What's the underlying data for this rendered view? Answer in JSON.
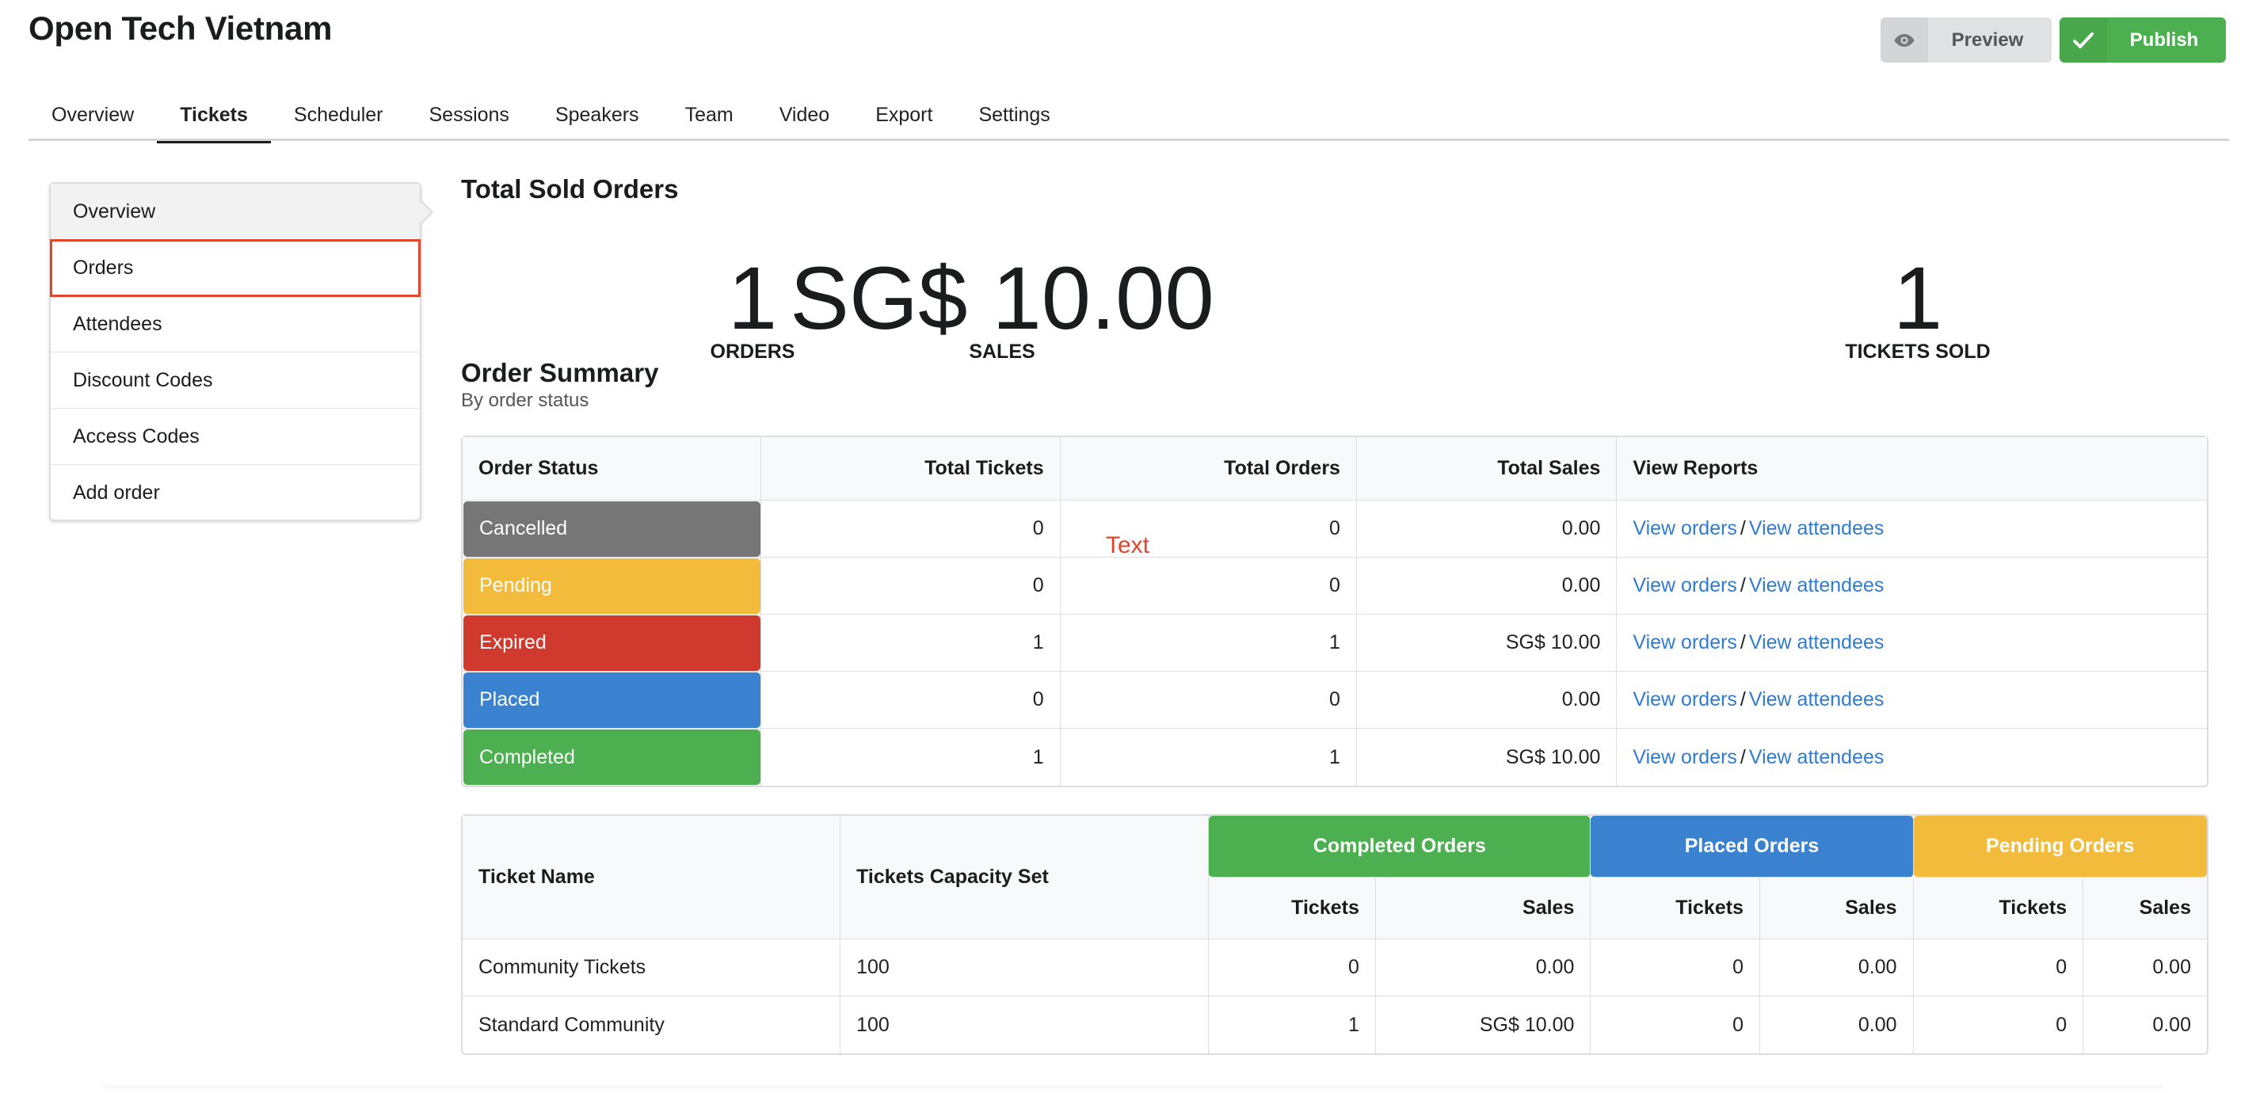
{
  "header": {
    "title": "Open Tech Vietnam",
    "preview_label": "Preview",
    "publish_label": "Publish"
  },
  "tabs": [
    {
      "label": "Overview"
    },
    {
      "label": "Tickets"
    },
    {
      "label": "Scheduler"
    },
    {
      "label": "Sessions"
    },
    {
      "label": "Speakers"
    },
    {
      "label": "Team"
    },
    {
      "label": "Video"
    },
    {
      "label": "Export"
    },
    {
      "label": "Settings"
    }
  ],
  "sidebar": {
    "items": [
      {
        "label": "Overview"
      },
      {
        "label": "Orders"
      },
      {
        "label": "Attendees"
      },
      {
        "label": "Discount Codes"
      },
      {
        "label": "Access Codes"
      },
      {
        "label": "Add order"
      }
    ]
  },
  "stats": {
    "title": "Total Sold Orders",
    "orders_value": "1",
    "orders_label": "ORDERS",
    "sales_value": "SG$ 10.00",
    "sales_label": "SALES",
    "tickets_value": "1",
    "tickets_label": "TICKETS SOLD"
  },
  "summary": {
    "title": "Order Summary",
    "subtitle": "By order status",
    "overlay_text": "Text",
    "headers": {
      "status": "Order Status",
      "tickets": "Total Tickets",
      "orders": "Total Orders",
      "sales": "Total Sales",
      "reports": "View Reports"
    },
    "links": {
      "orders": "View orders",
      "separator": "/",
      "attendees": "View attendees"
    },
    "rows": [
      {
        "status": "Cancelled",
        "tickets": "0",
        "orders": "0",
        "sales": "0.00"
      },
      {
        "status": "Pending",
        "tickets": "0",
        "orders": "0",
        "sales": "0.00"
      },
      {
        "status": "Expired",
        "tickets": "1",
        "orders": "1",
        "sales": "SG$ 10.00"
      },
      {
        "status": "Placed",
        "tickets": "0",
        "orders": "0",
        "sales": "0.00"
      },
      {
        "status": "Completed",
        "tickets": "1",
        "orders": "1",
        "sales": "SG$ 10.00"
      }
    ]
  },
  "status_colors": {
    "Cancelled": "#767676",
    "Pending": "#f2bb3c",
    "Expired": "#d0392e",
    "Placed": "#3a82cf",
    "Completed": "#4caf50"
  },
  "ticket_table": {
    "headers": {
      "name": "Ticket Name",
      "capacity": "Tickets Capacity Set",
      "completed": "Completed Orders",
      "placed": "Placed Orders",
      "pending": "Pending Orders",
      "tickets": "Tickets",
      "sales": "Sales"
    },
    "rows": [
      {
        "name": "Community Tickets",
        "capacity": "100",
        "completed_tickets": "0",
        "completed_sales": "0.00",
        "placed_tickets": "0",
        "placed_sales": "0.00",
        "pending_tickets": "0",
        "pending_sales": "0.00"
      },
      {
        "name": "Standard Community",
        "capacity": "100",
        "completed_tickets": "1",
        "completed_sales": "SG$ 10.00",
        "placed_tickets": "0",
        "placed_sales": "0.00",
        "pending_tickets": "0",
        "pending_sales": "0.00"
      }
    ]
  }
}
